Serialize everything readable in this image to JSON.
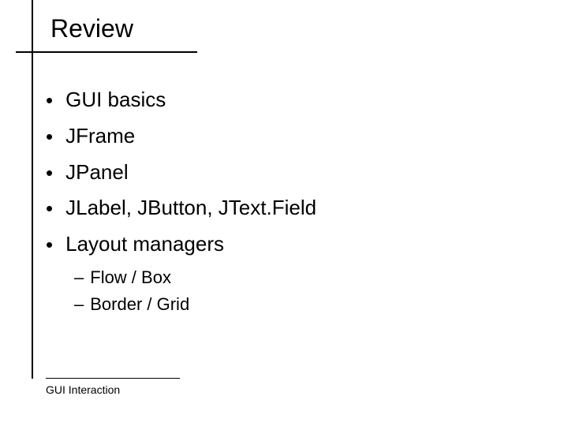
{
  "slide": {
    "title": "Review",
    "bullets": [
      "GUI basics",
      "JFrame",
      "JPanel",
      "JLabel, JButton, JText.Field",
      "Layout managers"
    ],
    "sub_bullets": [
      "Flow / Box",
      "Border / Grid"
    ],
    "footer": "GUI Interaction"
  }
}
